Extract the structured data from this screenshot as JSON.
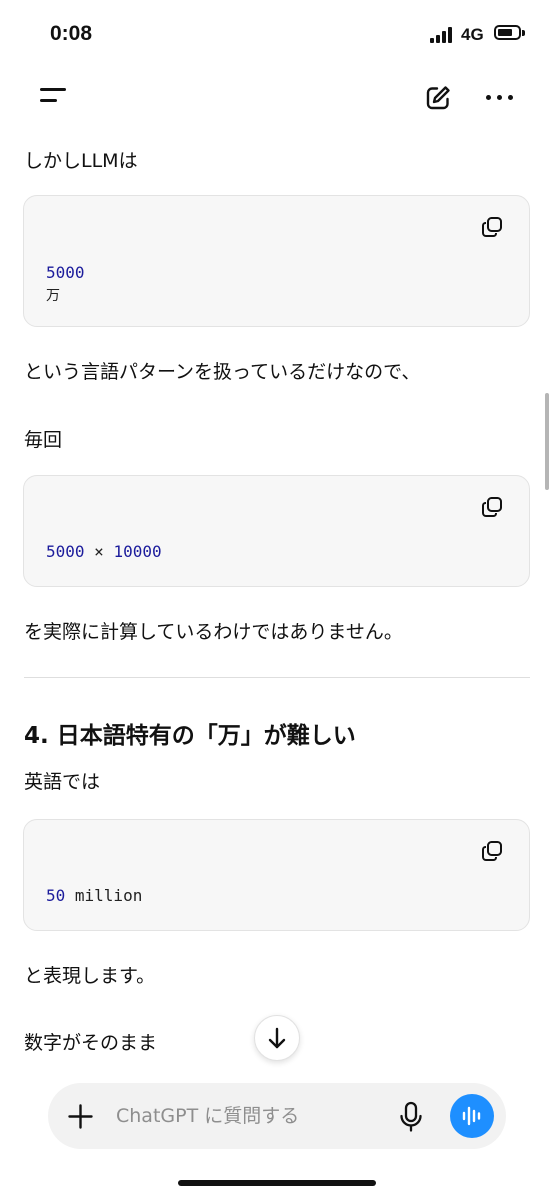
{
  "status_bar": {
    "time": "0:08",
    "network": "4G"
  },
  "messages": {
    "p1": "しかしLLMは",
    "code1": {
      "line1": "5000",
      "line2": "万"
    },
    "p2": "という言語パターンを扱っているだけなので、",
    "p3": "毎回",
    "code2": {
      "a": "5000",
      "op": " × ",
      "b": "10000"
    },
    "p4": "を実際に計算しているわけではありません。",
    "heading": "4. 日本語特有の「万」が難しい",
    "p5": "英語では",
    "code3": {
      "num": "50",
      "word": " million"
    },
    "p6": "と表現します。",
    "p7": "数字がそのまま"
  },
  "composer": {
    "placeholder": "ChatGPT に質問する"
  },
  "icons": {
    "menu": "menu-icon",
    "edit": "edit-icon",
    "more": "more-icon",
    "copy": "copy-icon",
    "scroll_down": "arrow-down-icon",
    "plus": "plus-icon",
    "mic": "mic-icon",
    "voice": "voice-waveform-icon"
  },
  "colors": {
    "code_number": "#1c1c9c",
    "voice_button": "#1e8fff",
    "code_background": "#f7f7f7"
  }
}
